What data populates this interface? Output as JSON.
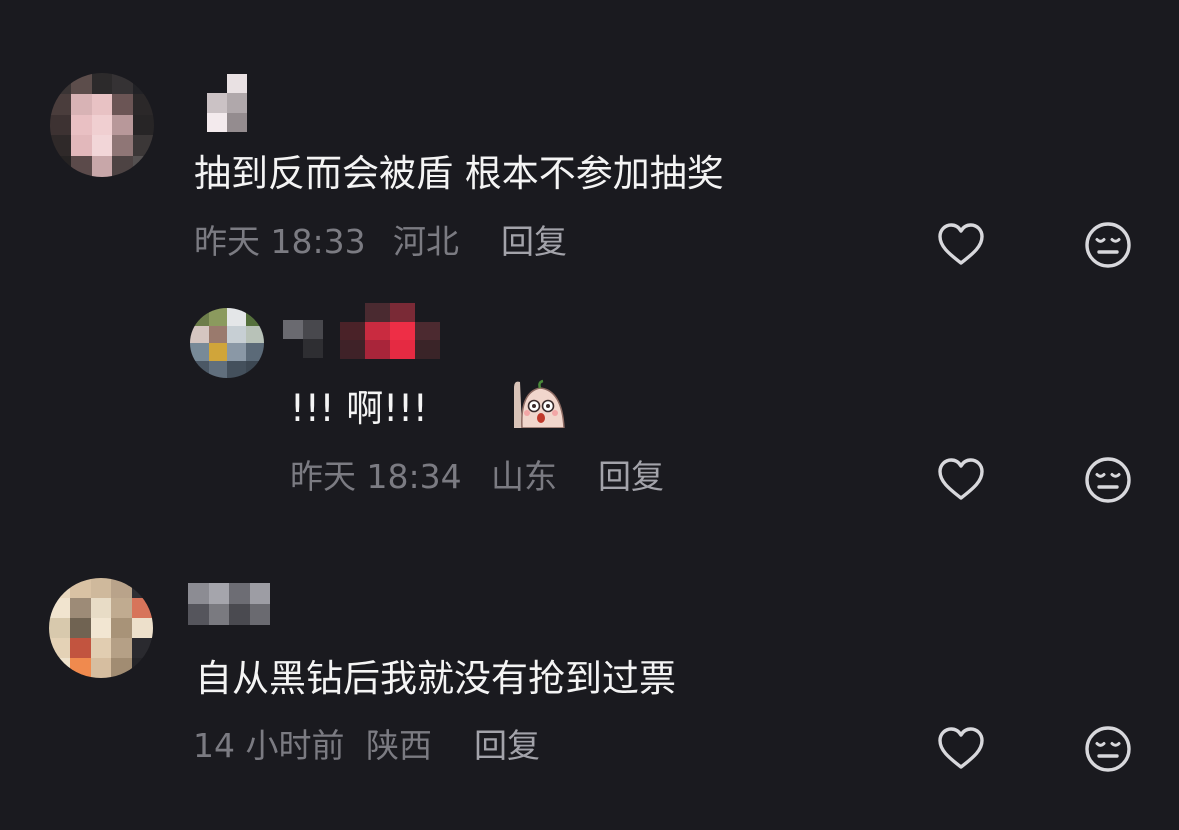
{
  "colors": {
    "background": "#1a1a1f",
    "text_primary": "#f4f4f4",
    "text_meta": "#7b7b82",
    "text_reply": "#a3a3aa",
    "icon": "#d8d8dc"
  },
  "comments": [
    {
      "text": "抽到反而会被盾 根本不参加抽奖",
      "time": "昨天 18:33",
      "location": "河北",
      "reply_label": "回复",
      "like_icon": "heart-outline-icon",
      "dislike_icon": "meh-face-icon"
    },
    {
      "text": "!!! 啊!!!",
      "sticker": "sticker-icon",
      "time": "昨天 18:34",
      "location": "山东",
      "reply_label": "回复",
      "like_icon": "heart-outline-icon",
      "dislike_icon": "meh-face-icon"
    },
    {
      "text": "自从黑钻后我就没有抢到过票",
      "time": "14 小时前",
      "location": "陕西",
      "reply_label": "回复",
      "like_icon": "heart-outline-icon",
      "dislike_icon": "meh-face-icon"
    }
  ]
}
